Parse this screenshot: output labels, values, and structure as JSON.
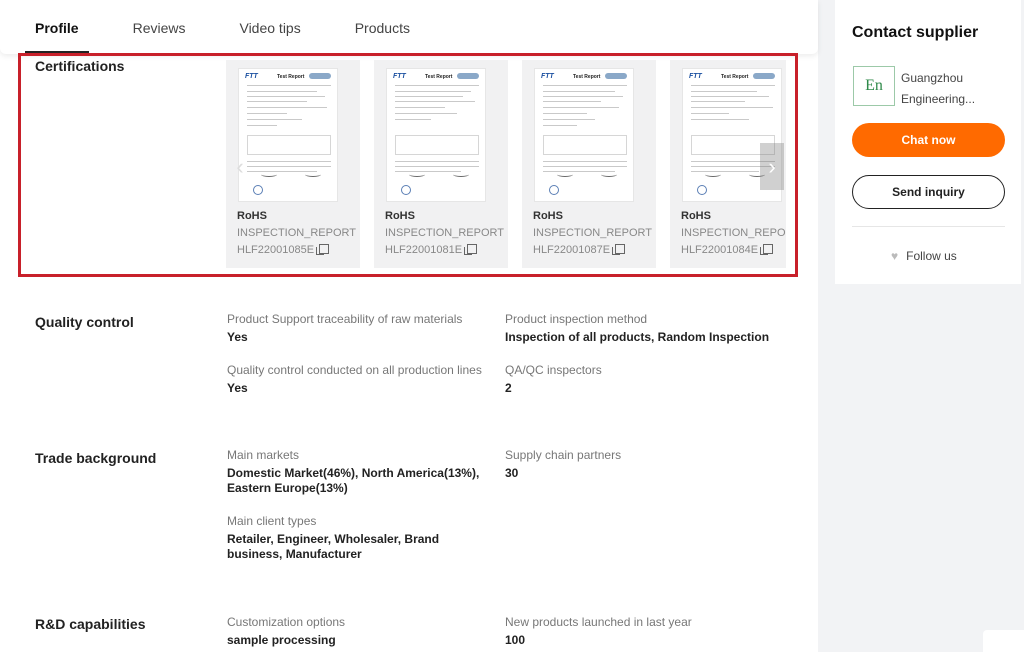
{
  "tabs": [
    {
      "label": "Profile",
      "active": true
    },
    {
      "label": "Reviews"
    },
    {
      "label": "Video tips"
    },
    {
      "label": "Products"
    }
  ],
  "certifications": {
    "title": "Certifications",
    "items": [
      {
        "type": "RoHS",
        "name": "INSPECTION_REPORT",
        "code": "HLF22001085E"
      },
      {
        "type": "RoHS",
        "name": "INSPECTION_REPORT",
        "code": "HLF22001081E"
      },
      {
        "type": "RoHS",
        "name": "INSPECTION_REPORT",
        "code": "HLF22001087E"
      },
      {
        "type": "RoHS",
        "name": "INSPECTION_REPOR",
        "code": "HLF22001084E"
      }
    ],
    "thumb_logo": "FTT",
    "thumb_header": "Test Report"
  },
  "quality_control": {
    "title": "Quality control",
    "fields": [
      {
        "label": "Product Support traceability of raw materials",
        "value": "Yes"
      },
      {
        "label": "Product inspection method",
        "value": "Inspection of all products, Random Inspection"
      },
      {
        "label": "Quality control conducted on all production lines",
        "value": "Yes"
      },
      {
        "label": "QA/QC inspectors",
        "value": "2"
      }
    ]
  },
  "trade_background": {
    "title": "Trade background",
    "fields": [
      {
        "label": "Main markets",
        "value": "Domestic Market(46%), North America(13%), Eastern Europe(13%)"
      },
      {
        "label": "Supply chain partners",
        "value": "30"
      },
      {
        "label": "Main client types",
        "value": "Retailer, Engineer, Wholesaler, Brand business, Manufacturer"
      }
    ]
  },
  "rd": {
    "title": "R&D capabilities",
    "fields": [
      {
        "label": "Customization options",
        "value": "sample processing"
      },
      {
        "label": "New products launched in last year",
        "value": "100"
      }
    ]
  },
  "sidebar": {
    "title": "Contact supplier",
    "supplier_name_line1": "Guangzhou",
    "supplier_name_line2": "Engineering...",
    "logo_text": "En",
    "chat_label": "Chat now",
    "inquiry_label": "Send inquiry",
    "follow_label": "Follow us"
  },
  "colors": {
    "accent": "#ff6a00",
    "highlight_box": "#c8202a"
  }
}
